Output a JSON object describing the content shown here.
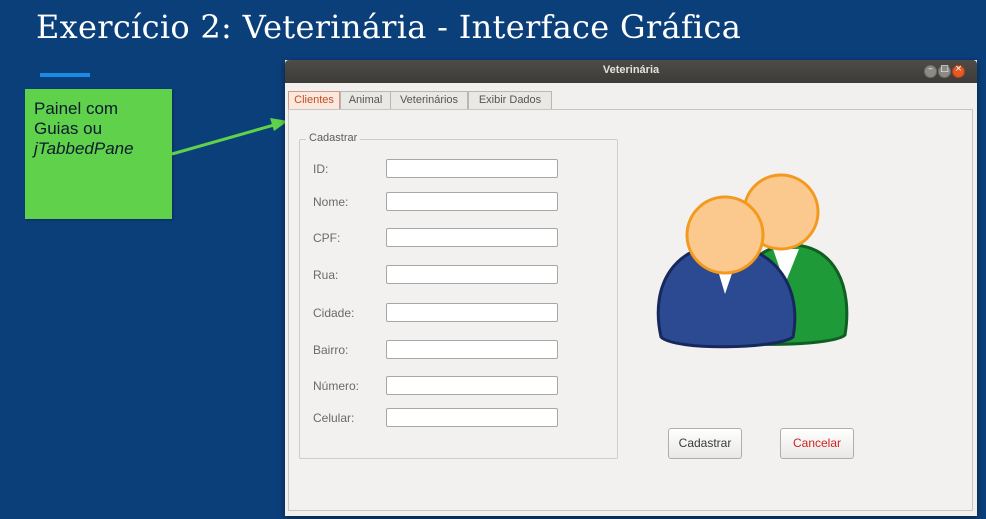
{
  "slide": {
    "title": "Exercício 2: Veterinária - Interface Gráfica",
    "note_lines": [
      "Painel com",
      "Guias ou",
      "jTabbedPane"
    ]
  },
  "window": {
    "title": "Veterinária",
    "controls": [
      "minimize",
      "maximize",
      "close"
    ]
  },
  "tabs": [
    {
      "label": "Clientes",
      "active": true
    },
    {
      "label": "Animal",
      "active": false
    },
    {
      "label": "Veterinários",
      "active": false
    },
    {
      "label": "Exibir Dados",
      "active": false
    }
  ],
  "form": {
    "legend": "Cadastrar",
    "fields": [
      {
        "label": "ID:",
        "value": ""
      },
      {
        "label": "Nome:",
        "value": ""
      },
      {
        "label": "CPF:",
        "value": ""
      },
      {
        "label": "Rua:",
        "value": ""
      },
      {
        "label": "Cidade:",
        "value": ""
      },
      {
        "label": "Bairro:",
        "value": ""
      },
      {
        "label": "Número:",
        "value": ""
      },
      {
        "label": "Celular:",
        "value": ""
      }
    ]
  },
  "actions": {
    "submit_label": "Cadastrar",
    "cancel_label": "Cancelar"
  },
  "icons": {
    "illustration": "users-icon"
  },
  "colors": {
    "slide_bg": "#0b3f7a",
    "note_bg": "#5fd14a",
    "arrow": "#5fd14a",
    "active_tab_text": "#c24e20",
    "cancel_text": "#d21f1f",
    "person_front_suit": "#2c4a92",
    "person_back_suit": "#1e9a38",
    "skin": "#fbc98d"
  }
}
